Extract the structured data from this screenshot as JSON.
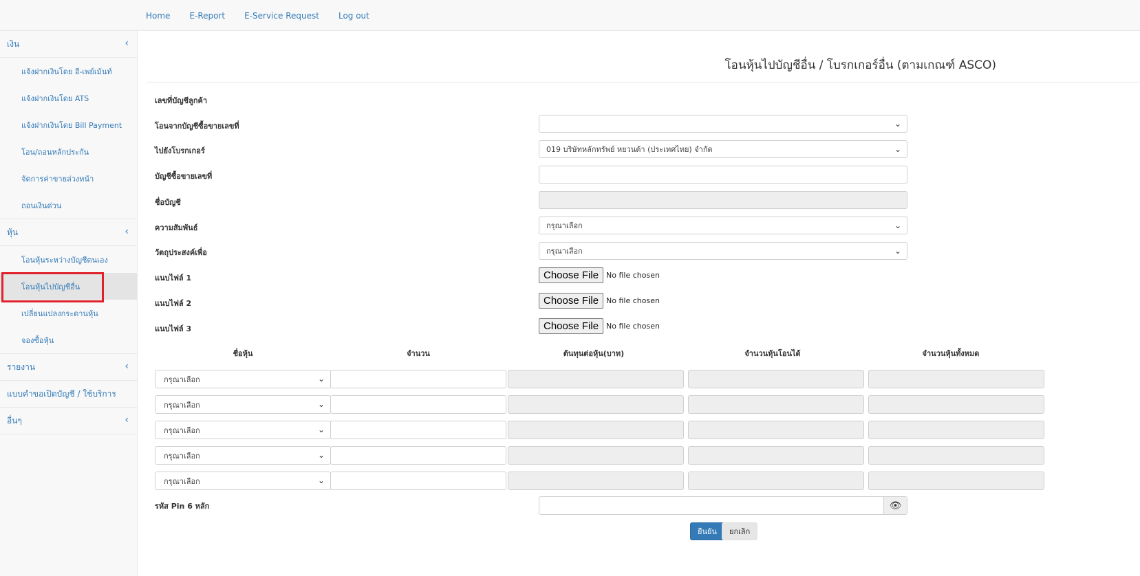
{
  "topnav": [
    "Home",
    "E-Report",
    "E-Service Request",
    "Log out"
  ],
  "sidebar": {
    "money": {
      "title": "เงิน",
      "items": [
        "แจ้งฝากเงินโดย อี-เพย์เม้นท์",
        "แจ้งฝากเงินโดย ATS",
        "แจ้งฝากเงินโดย Bill Payment",
        "โอน/ถอนหลักประกัน",
        "จัดการค่าขายล่วงหน้า",
        "ถอนเงินด่วน"
      ]
    },
    "stock": {
      "title": "หุ้น",
      "items": [
        "โอนหุ้นระหว่างบัญชีตนเอง",
        "โอนหุ้นไปบัญชีอื่น",
        "เปลี่ยนแปลงกระดานหุ้น",
        "จองซื้อหุ้น"
      ]
    },
    "report": "รายงาน",
    "account_form": "แบบคำขอเปิดบัญชี / ใช้บริการ",
    "other": "อื่นๆ"
  },
  "page_title": "โอนหุ้นไปบัญชีอื่น / โบรกเกอร์อื่น (ตามเกณฑ์ ASCO)",
  "form": {
    "customer_account_label": "เลขที่บัญชีลูกค้า",
    "from_account_label": "โอนจากบัญชีซื้อขายเลขที่",
    "from_account_value": "",
    "to_broker_label": "ไปยังโบรกเกอร์",
    "to_broker_value": "019 บริษัทหลักทรัพย์ หยวนต้า (ประเทศไทย) จำกัด",
    "trading_account_label": "บัญชีซื้อขายเลขที่",
    "account_name_label": "ชื่อบัญชี",
    "relation_label": "ความสัมพันธ์",
    "relation_value": "กรุณาเลือก",
    "purpose_label": "วัตถุประสงค์เพื่อ",
    "purpose_value": "กรุณาเลือก",
    "attach1_label": "แนบไฟล์ 1",
    "attach2_label": "แนบไฟล์ 2",
    "attach3_label": "แนบไฟล์ 3",
    "choose_file": "Choose File",
    "no_file": "No file chosen",
    "pin_label": "รหัส Pin 6 หลัก"
  },
  "table": {
    "headers": [
      "ชื่อหุ้น",
      "จำนวน",
      "ต้นทุนต่อหุ้น(บาท)",
      "จำนวนหุ้นโอนได้",
      "จำนวนหุ้นทั้งหมด"
    ],
    "select_placeholder": "กรุณาเลือก"
  },
  "buttons": {
    "confirm": "ยืนยัน",
    "cancel": "ยกเลิก"
  }
}
